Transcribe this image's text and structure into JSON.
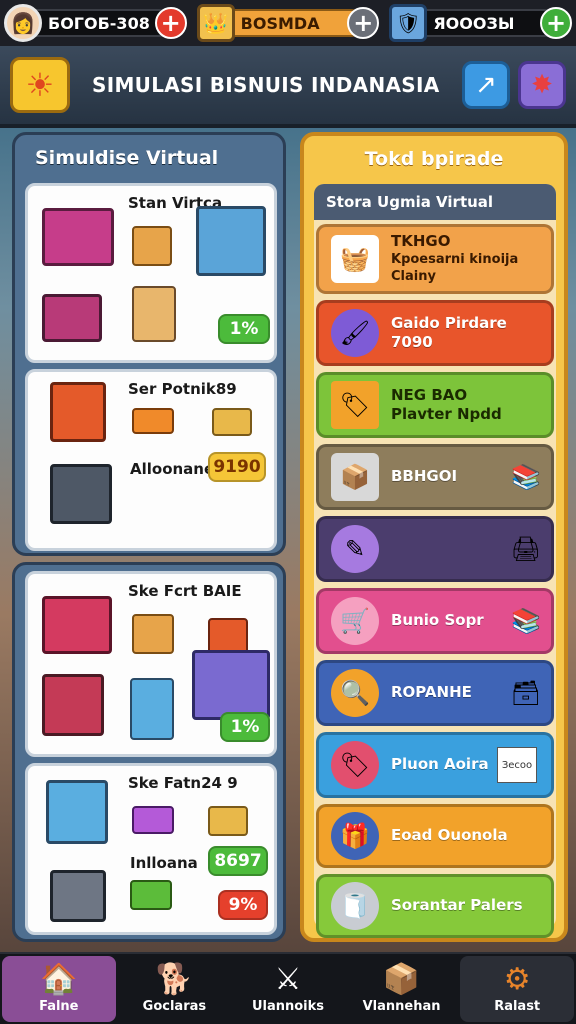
{
  "resources": [
    {
      "value": "БОГОБ-308",
      "plus": "+",
      "avatar": "👩"
    },
    {
      "value": "BOSMDA",
      "plus": "+",
      "avatar": "👑"
    },
    {
      "value": "ЯОООЗЫ",
      "plus": "+",
      "avatar": "🛡"
    }
  ],
  "header": {
    "title": "SIMULASI BISNUIS INDANASIA",
    "sun_icon": "☀",
    "link_icon": "↗",
    "settings_icon": "✸"
  },
  "left": {
    "title": "Simuldise Virtual",
    "cards": [
      {
        "title": "Stan Virtca",
        "badge": "1%"
      },
      {
        "title": "Ser Potnik89",
        "sub": "Alloonane",
        "badge": "9190"
      },
      {
        "title": "Ske Fcrt BAIE",
        "badge": "1%"
      },
      {
        "title": "Ske Fatn24 9",
        "sub": "Inlloana",
        "badge": "8697",
        "badge2": "9%"
      }
    ]
  },
  "right": {
    "title": "Tokd bpirade",
    "store_title": "Stora Ugmia Virtual",
    "shops": [
      {
        "line1": "TKHGO",
        "line2": "Kpoesarni kinoija",
        "line3": "Clainy",
        "color": "#f2a24a",
        "icon": "🧺"
      },
      {
        "line1": "Gaido Pirdare",
        "line2": "7090",
        "color": "#e8552b",
        "icon": "🖌"
      },
      {
        "line1": "NEG BAO",
        "line2": "Plavter Npdd",
        "color": "#7dc43a",
        "icon": "🏷"
      },
      {
        "line1": "BBHGOI",
        "color": "#8e7d5c",
        "icon": "📦"
      },
      {
        "line1": "",
        "color": "#4b3d6d",
        "icon": "✎"
      },
      {
        "line1": "Bunio Sopr",
        "color": "#e24f8e",
        "icon": "🛒"
      },
      {
        "line1": "ROPANHE",
        "color": "#3f64b6",
        "icon": "🔍"
      },
      {
        "line1": "Pluon Aoira",
        "tag": "Зесоо",
        "color": "#3aa0de",
        "icon": "🏷"
      },
      {
        "line1": "Eoad Ouonola",
        "color": "#f2a22a",
        "icon": "🎁"
      },
      {
        "line1": "Sorantar Palers",
        "color": "#86c93a",
        "icon": "🧻"
      }
    ]
  },
  "nav": [
    {
      "label": "Falne",
      "icon": "🏠"
    },
    {
      "label": "Goclaras",
      "icon": "🐕"
    },
    {
      "label": "Ulannoiks",
      "icon": "⚔"
    },
    {
      "label": "Vlannehan",
      "icon": "📦"
    },
    {
      "label": "Ralast",
      "icon": "⚙"
    }
  ]
}
